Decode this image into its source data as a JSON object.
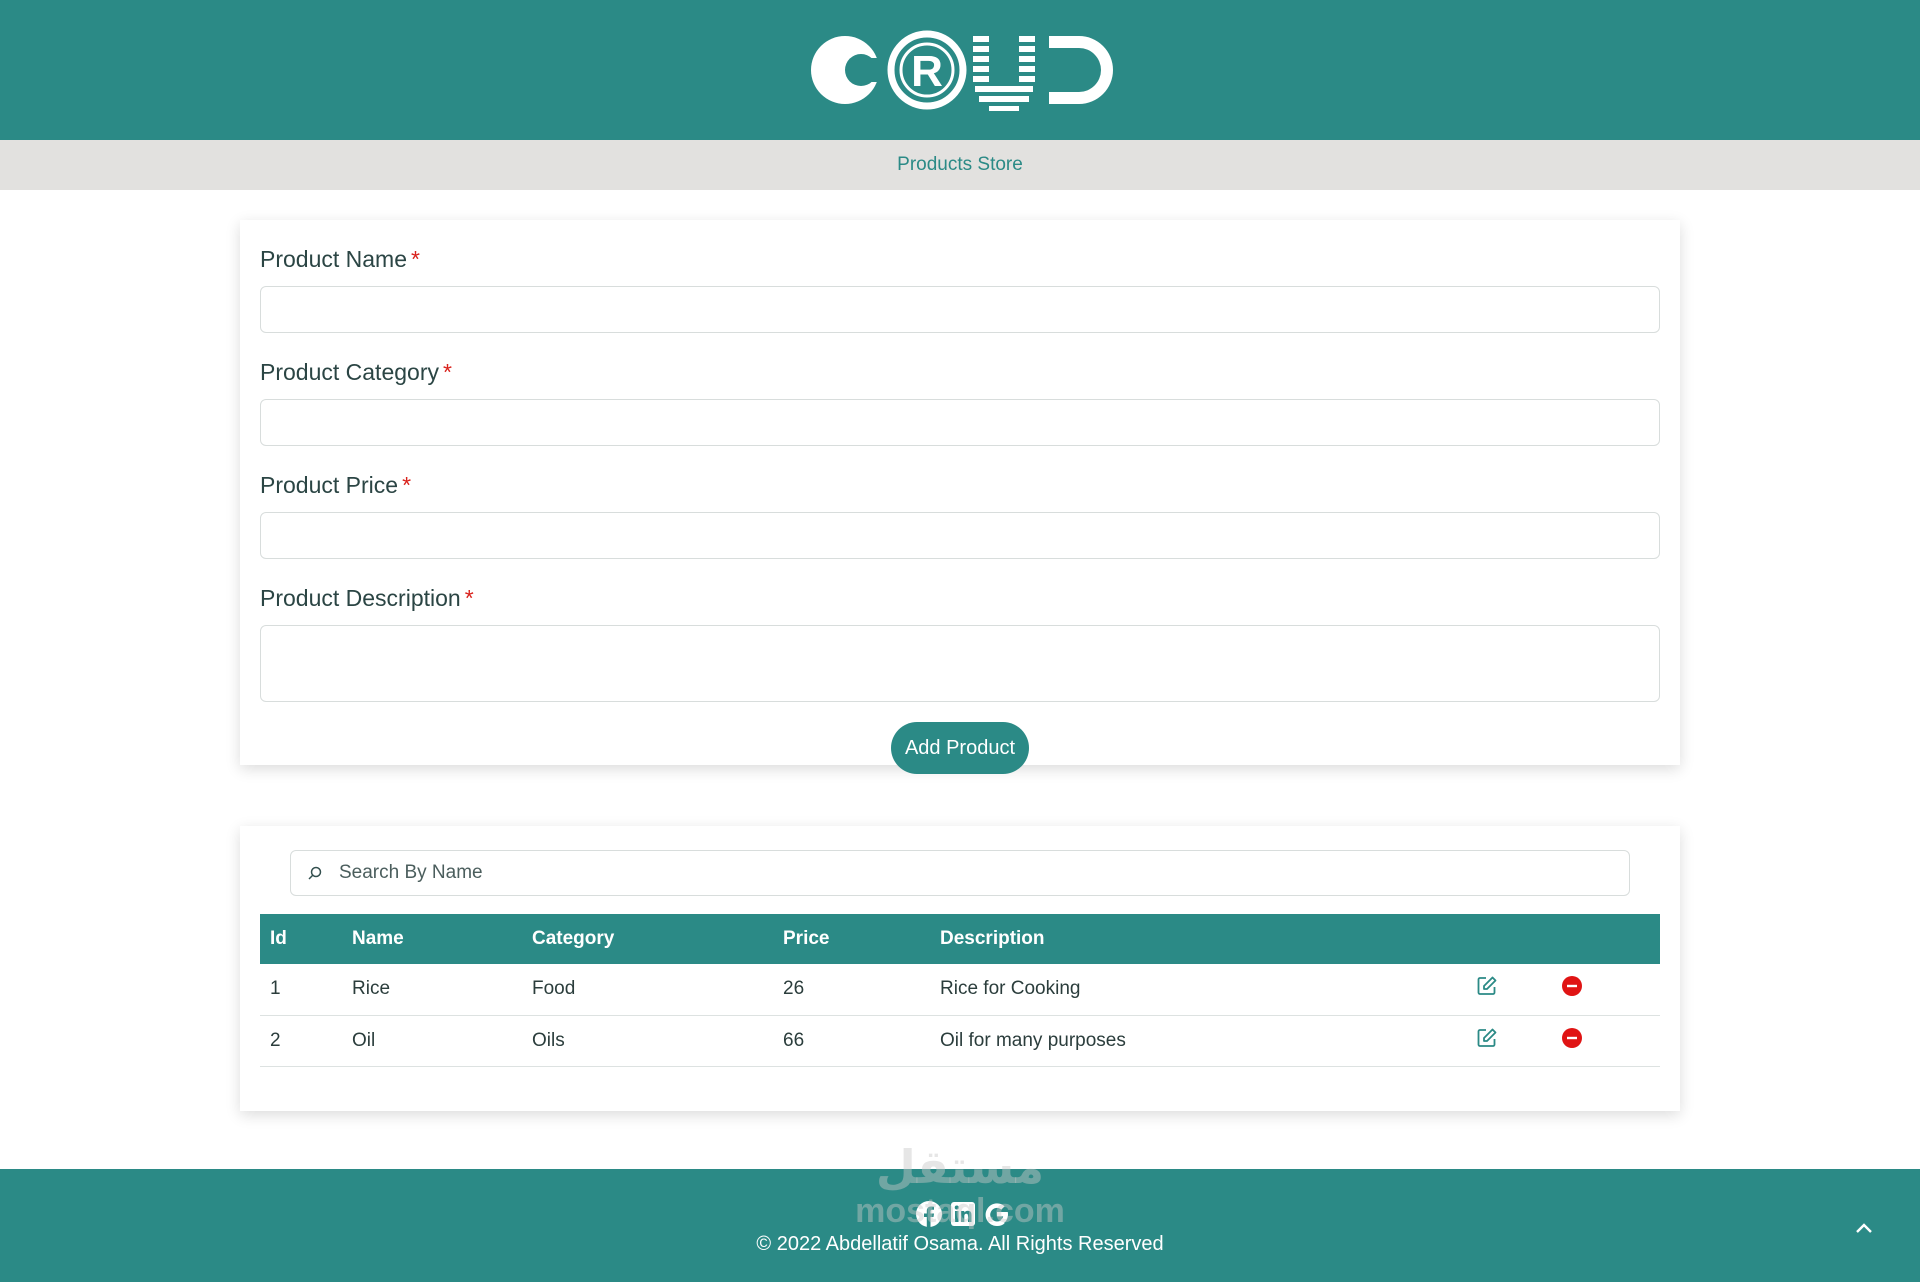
{
  "header": {
    "logo_alt": "CRUD"
  },
  "subbar": {
    "title": "Products Store"
  },
  "form": {
    "fields": [
      {
        "label": "Product Name",
        "required_mark": "*",
        "value": ""
      },
      {
        "label": "Product Category",
        "required_mark": "*",
        "value": ""
      },
      {
        "label": "Product Price",
        "required_mark": "*",
        "value": ""
      },
      {
        "label": "Product Description",
        "required_mark": "*",
        "value": ""
      }
    ],
    "submit_label": "Add Product"
  },
  "search": {
    "placeholder": "Search By Name"
  },
  "table": {
    "headers": [
      "Id",
      "Name",
      "Category",
      "Price",
      "Description"
    ],
    "rows": [
      {
        "id": "1",
        "name": "Rice",
        "category": "Food",
        "price": "26",
        "description": "Rice for Cooking"
      },
      {
        "id": "2",
        "name": "Oil",
        "category": "Oils",
        "price": "66",
        "description": "Oil for many purposes"
      }
    ]
  },
  "footer": {
    "social_icons": [
      "facebook-icon",
      "linkedin-icon",
      "google-icon"
    ],
    "copyright": "2022 Abdellatif Osama. All Rights Reserved"
  },
  "watermark": {
    "arabic": "مستقل",
    "latin": "mostaql.com"
  },
  "colors": {
    "primary": "#2b8a86",
    "subbar": "#e2e1df",
    "danger": "#e01414"
  }
}
